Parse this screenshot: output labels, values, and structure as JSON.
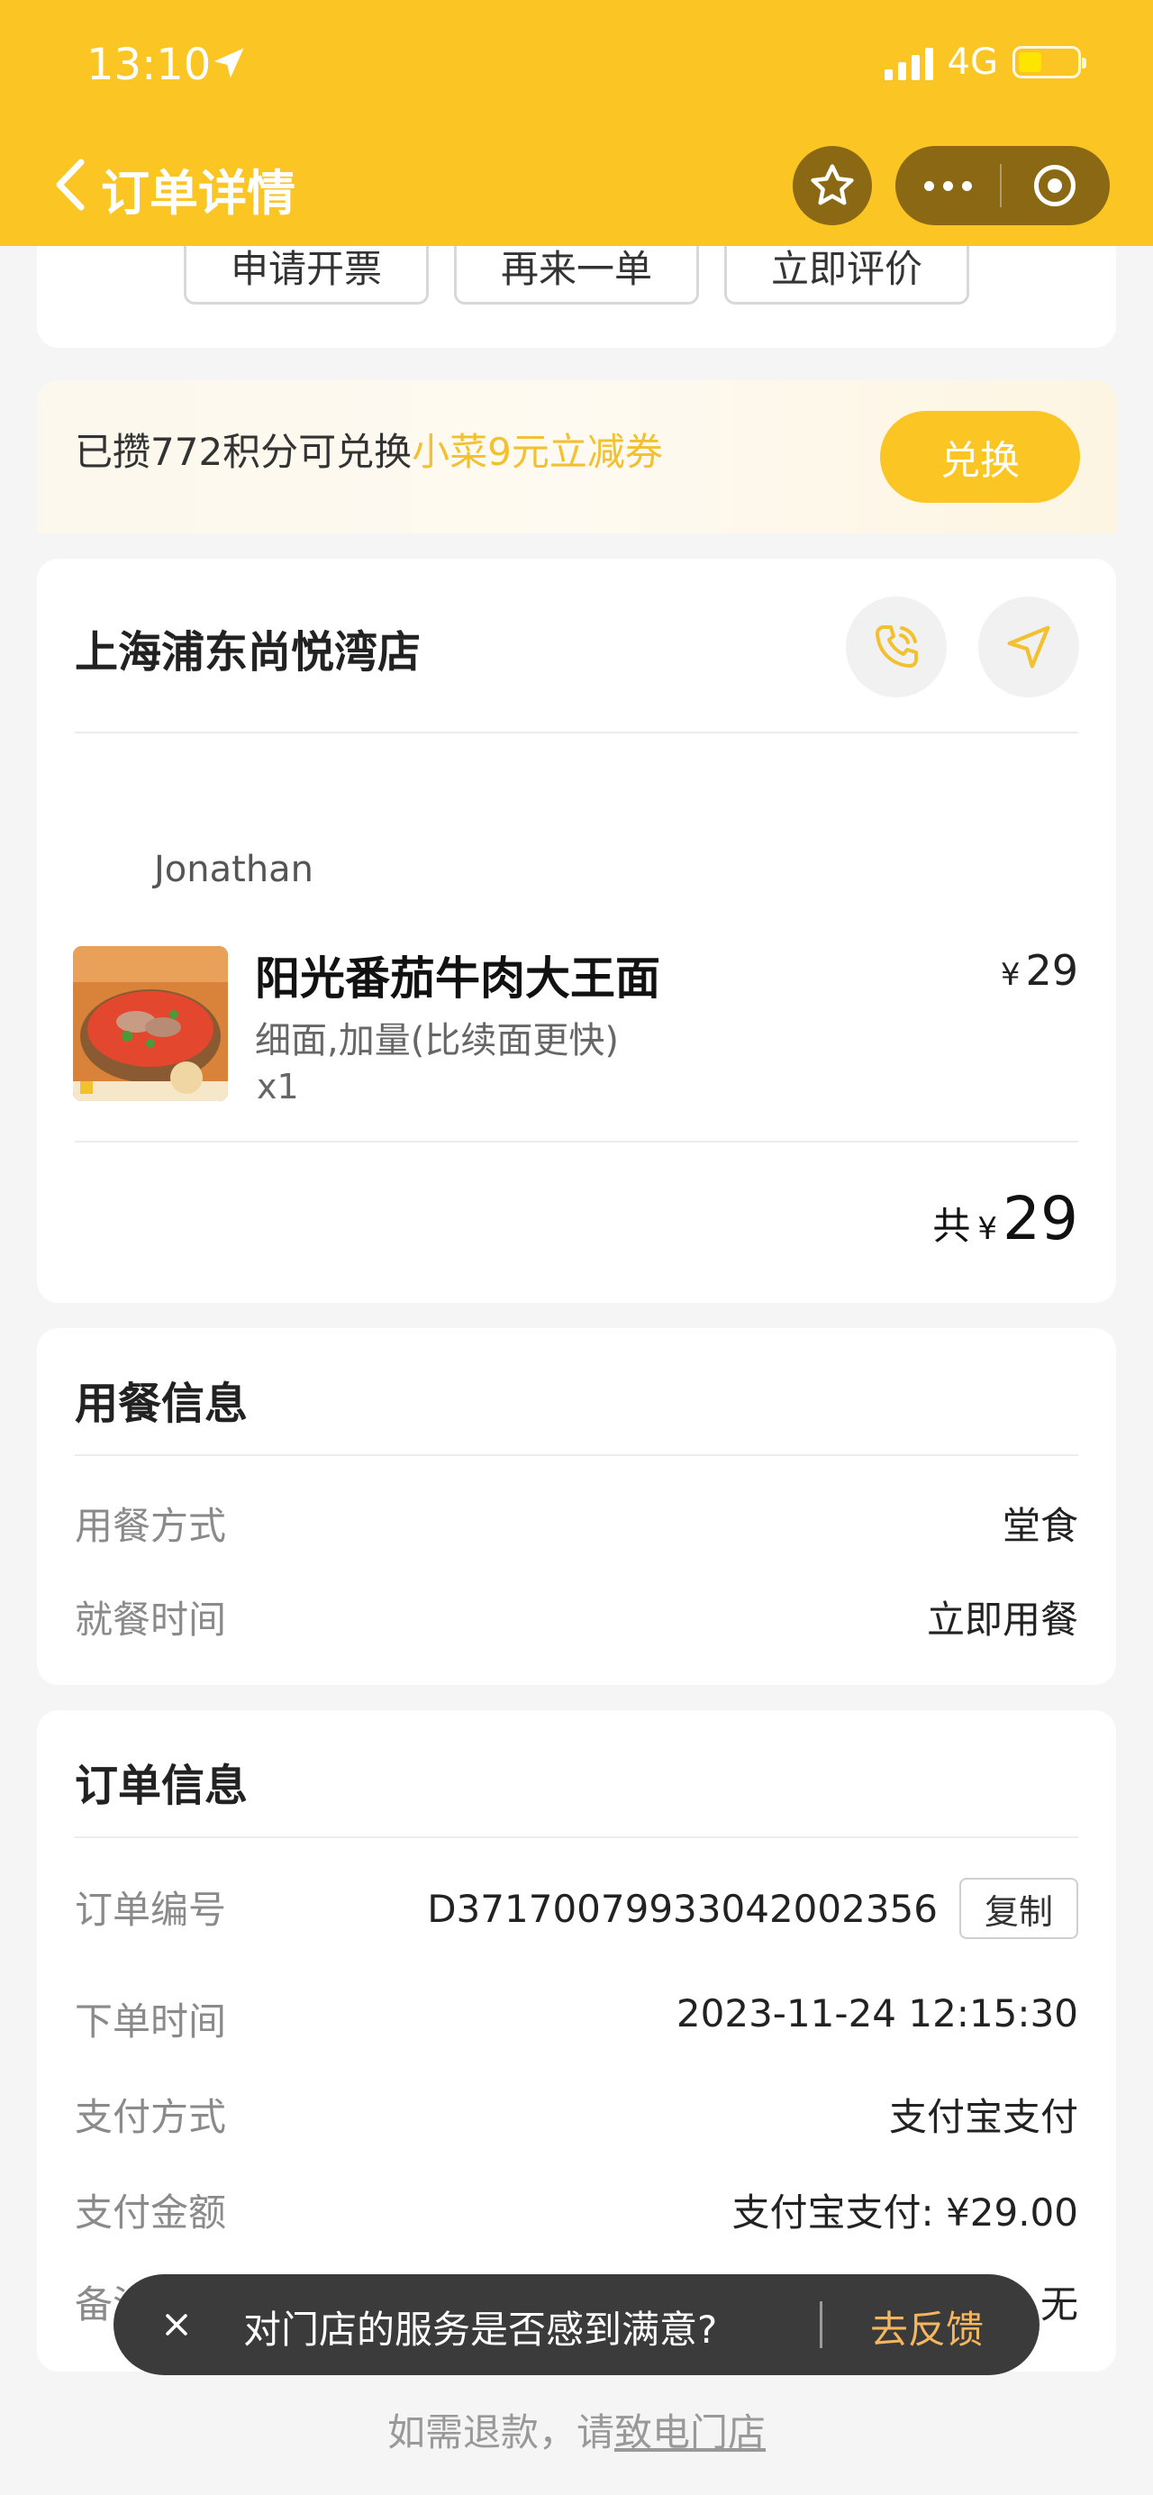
{
  "status_bar": {
    "time": "13:10",
    "network": "4G"
  },
  "nav": {
    "title": "订单详情"
  },
  "actions": {
    "invoice": "申请开票",
    "reorder": "再来一单",
    "review": "立即评价"
  },
  "points": {
    "prefix": "已攒772积分可兑换",
    "highlight": "小菜9元立减券",
    "button": "兑换",
    "highlight_color": "#f3c030"
  },
  "store": {
    "name": "上海浦东尚悦湾店",
    "customer": "Jonathan",
    "item": {
      "name": "阳光番茄牛肉大王面",
      "spec": "细面,加量(比续面更快)",
      "qty": "x1",
      "currency": "¥",
      "price": "29"
    },
    "total": {
      "label": "共",
      "currency": "¥",
      "amount": "29"
    }
  },
  "dining": {
    "title": "用餐信息",
    "rows": [
      {
        "label": "用餐方式",
        "value": "堂食"
      },
      {
        "label": "就餐时间",
        "value": "立即用餐"
      }
    ]
  },
  "order": {
    "title": "订单信息",
    "copy_label": "复制",
    "rows": [
      {
        "label": "订单编号",
        "value": "D37170079933042002356"
      },
      {
        "label": "下单时间",
        "value": "2023-11-24 12:15:30"
      },
      {
        "label": "支付方式",
        "value": "支付宝支付"
      },
      {
        "label": "支付金额",
        "value": "支付宝支付: ¥29.00"
      },
      {
        "label": "备注信息",
        "value": "无"
      }
    ]
  },
  "toast": {
    "text": "对门店的服务是否感到满意?",
    "action": "去反馈"
  },
  "footer": {
    "prefix": "如需退款，请",
    "link": "致电门店"
  },
  "colors": {
    "brand": "#fbc524",
    "capsule": "#8b6914",
    "toast_action": "#f4b760"
  }
}
